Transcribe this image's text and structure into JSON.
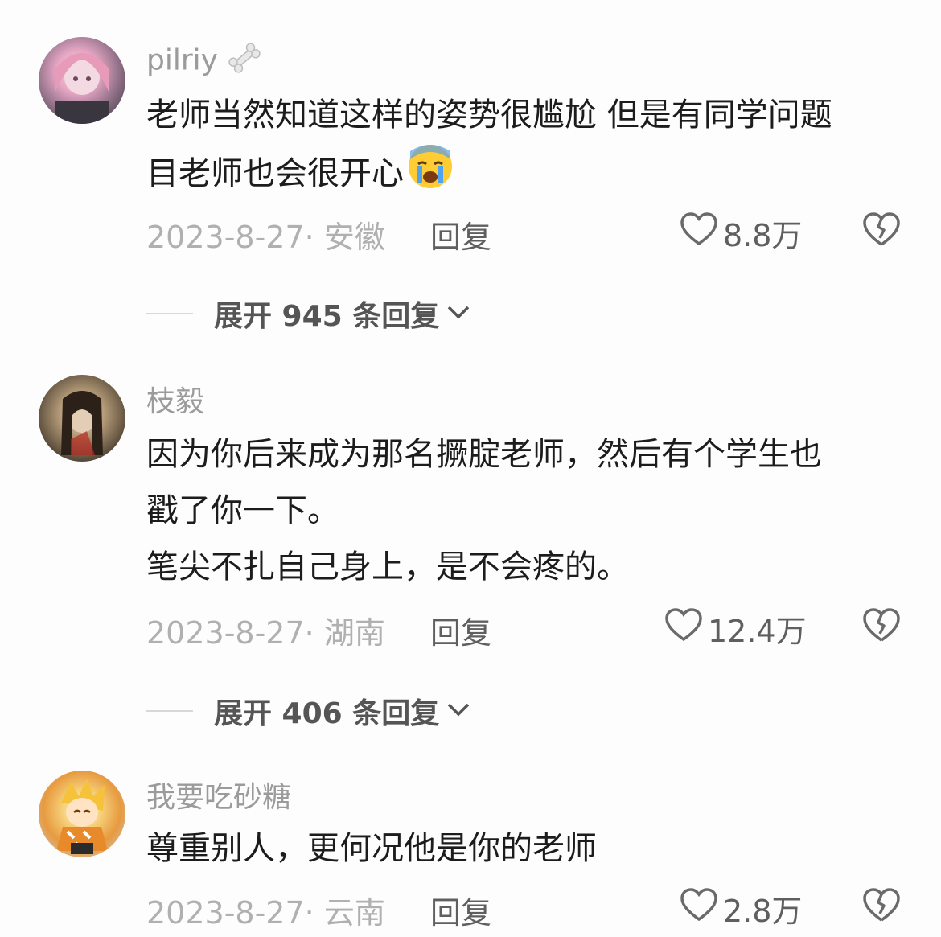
{
  "comments": [
    {
      "username": "pilriy",
      "username_icon": "bone-icon",
      "lines": [
        "老师当然知道这样的姿势很尴尬 但是有同学问题",
        "目老师也会很开心"
      ],
      "emoji": "crying-face-emoji",
      "meta": "2023-8-27· 安徽",
      "reply_label": "回复",
      "likes": "8.8万",
      "expand_label": "展开 945 条回复"
    },
    {
      "username": "枝毅",
      "lines": [
        "因为你后来成为那名撅腚老师，然后有个学生也",
        "戳了你一下。",
        "笔尖不扎自己身上，是不会疼的。"
      ],
      "meta": "2023-8-27· 湖南",
      "reply_label": "回复",
      "likes": "12.4万",
      "expand_label": "展开 406 条回复"
    },
    {
      "username": "我要吃砂糖",
      "lines": [
        "尊重别人，更何况他是你的老师"
      ],
      "meta": "2023-8-27· 云南",
      "reply_label": "回复",
      "likes": "2.8万"
    }
  ]
}
